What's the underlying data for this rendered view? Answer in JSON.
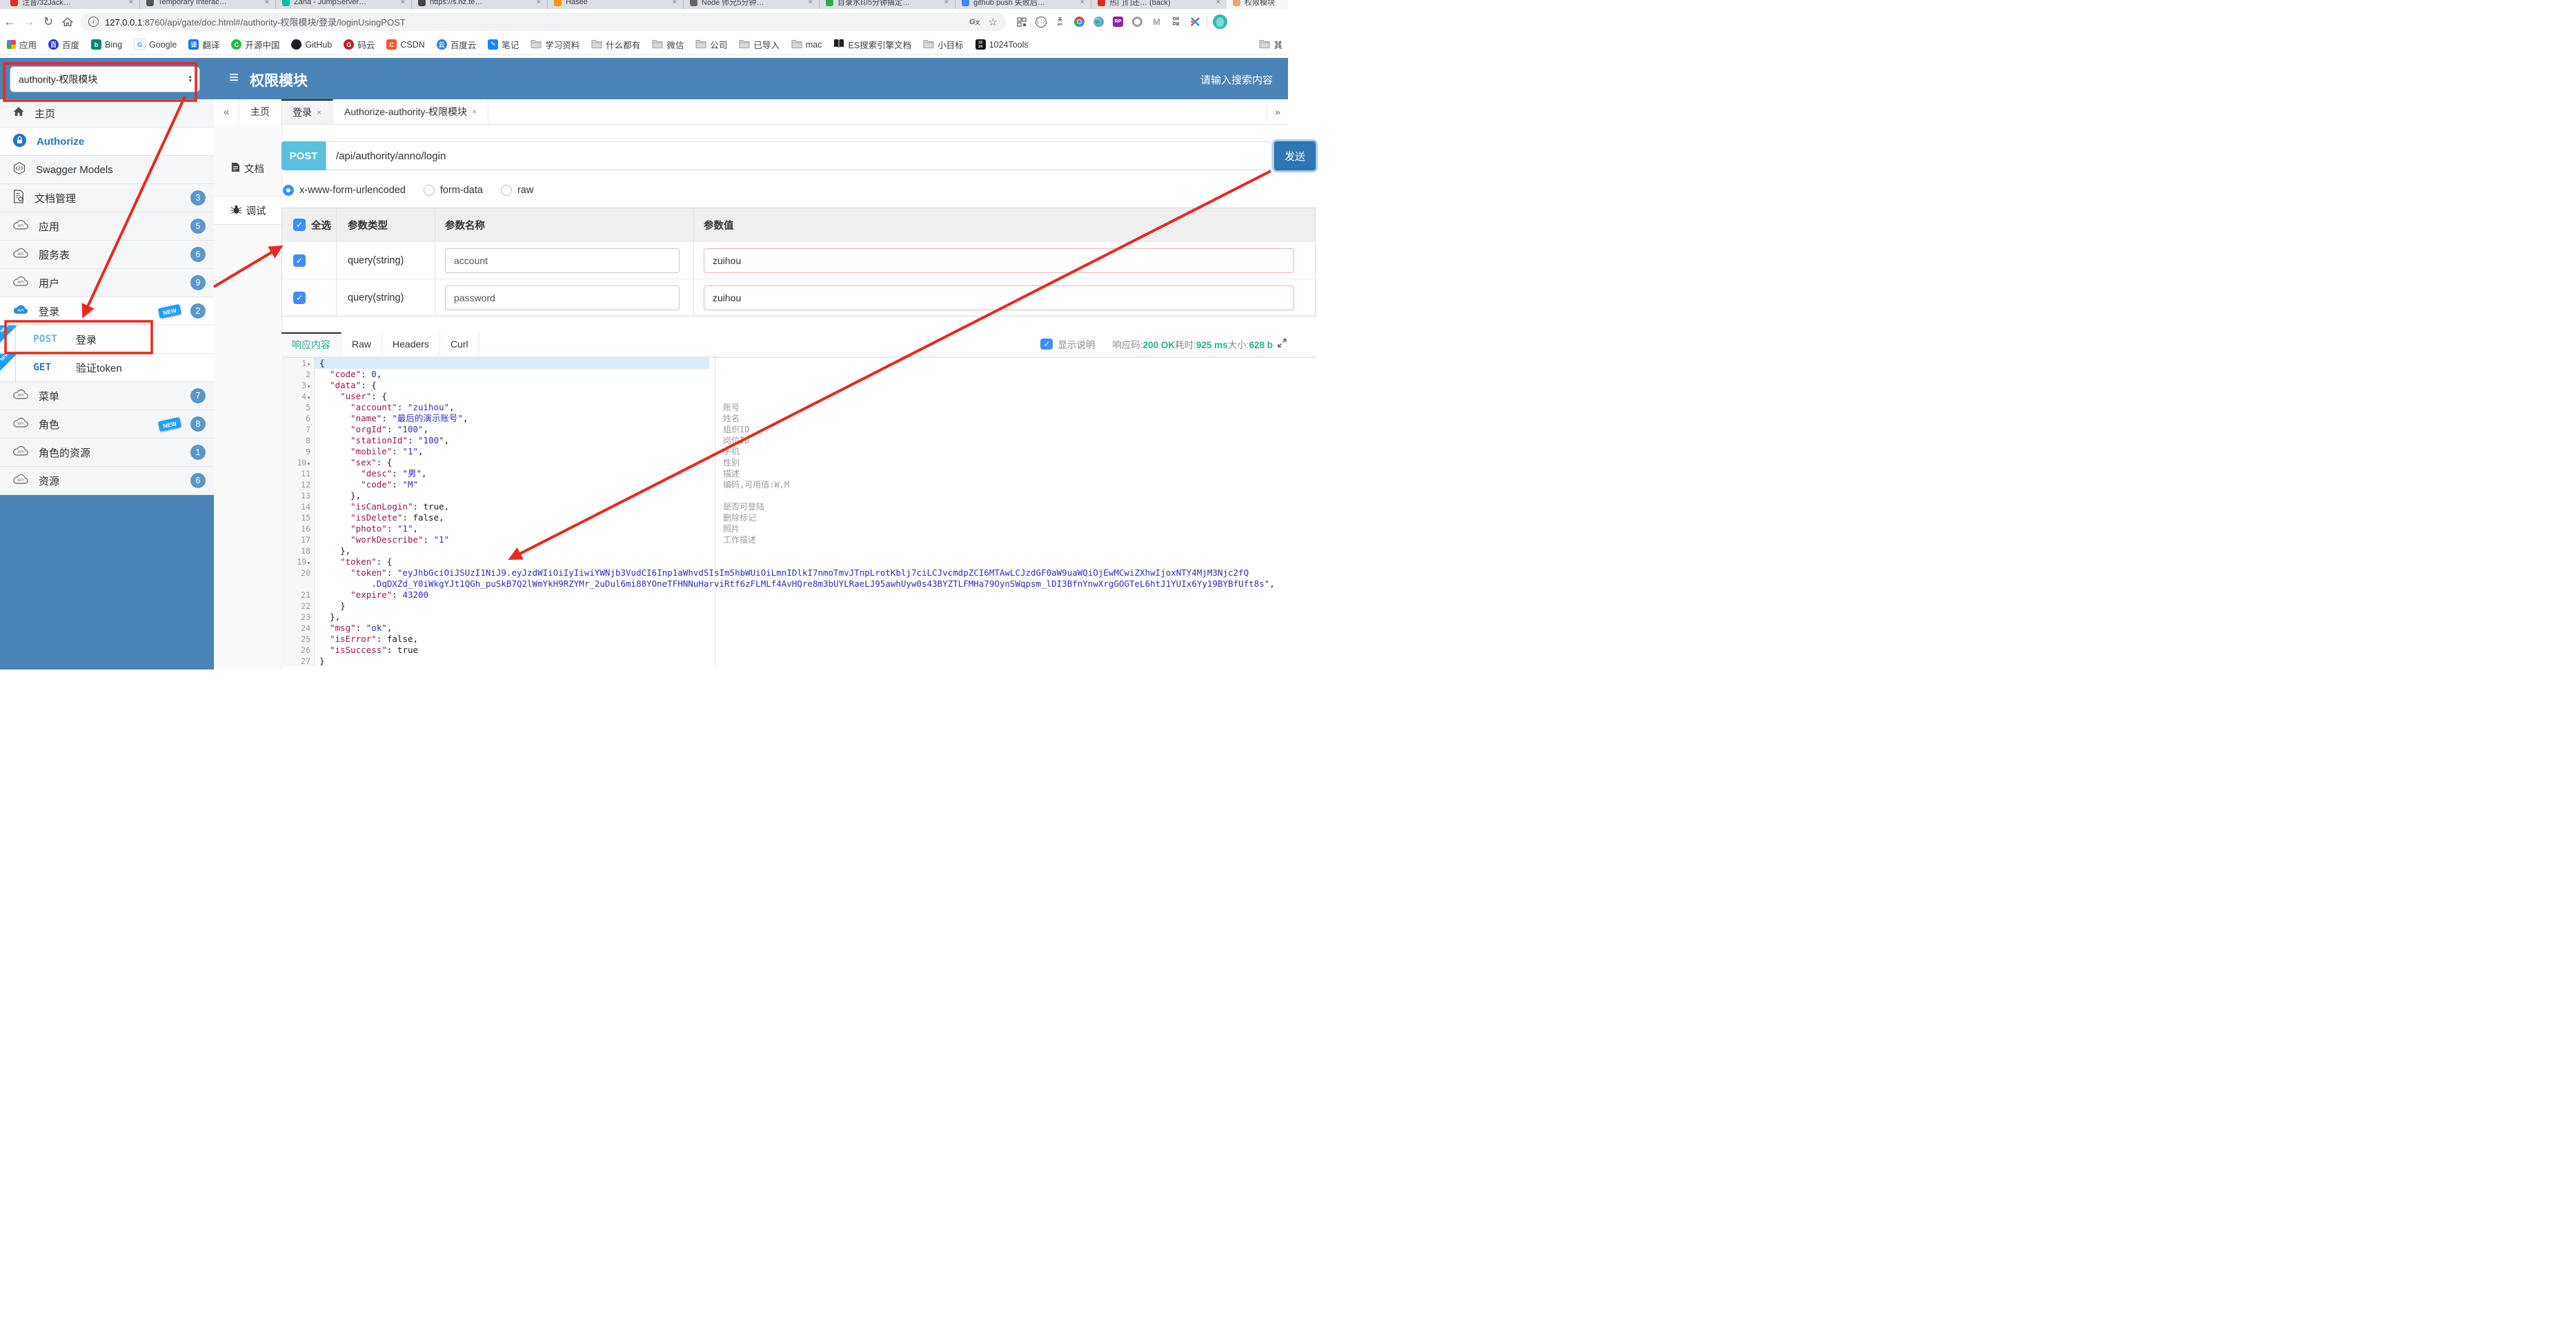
{
  "browser": {
    "tabs": [
      {
        "label": "注音/32Jack…",
        "favicon": "#d93025"
      },
      {
        "label": "Temporary Interac…",
        "favicon": "#555555"
      },
      {
        "label": "Zana - JumpServer…",
        "favicon": "#14b8a6"
      },
      {
        "label": "https://s.nz.te…",
        "favicon": "#444444"
      },
      {
        "label": "Hasee",
        "favicon": "#f29900"
      },
      {
        "label": "Node 师兄5分钟…",
        "favicon": "#666666"
      },
      {
        "label": "目录水印5分钟搞定…",
        "favicon": "#34a853"
      },
      {
        "label": "github push 失败后…",
        "favicon": "#4285f4"
      },
      {
        "label": "热门们还… (back)",
        "favicon": "#d93025"
      },
      {
        "label": "权限模块",
        "favicon": "#e8a87c",
        "active": true
      }
    ],
    "nav": {
      "back": "←",
      "forward": "→",
      "reload": "↻"
    },
    "url_host": "127.0.0.1",
    "url_rest": ":8760/api/gate/doc.html#/authority-权限模块/登录/loginUsingPOST",
    "bookmarks": [
      {
        "label": "应用",
        "icon": "grid"
      },
      {
        "label": "百度",
        "icon": "circle",
        "bg": "#2932e1",
        "ch": "百"
      },
      {
        "label": "Bing",
        "icon": "square",
        "bg": "#008373",
        "ch": "b"
      },
      {
        "label": "Google",
        "icon": "square",
        "bg": "#ffffff",
        "ch": "G",
        "fg": "#4285f4"
      },
      {
        "label": "翻译",
        "icon": "square",
        "bg": "#1a73e8",
        "ch": "译"
      },
      {
        "label": "开源中国",
        "icon": "circle",
        "bg": "#21ba45",
        "ch": "C"
      },
      {
        "label": "GitHub",
        "icon": "circle",
        "bg": "#1b1f23",
        "ch": ""
      },
      {
        "label": "码云",
        "icon": "circle",
        "bg": "#c71d23",
        "ch": "G"
      },
      {
        "label": "CSDN",
        "icon": "square",
        "bg": "#fc5531",
        "ch": "C"
      },
      {
        "label": "百度云",
        "icon": "circle",
        "bg": "#2b7de9",
        "ch": "云"
      },
      {
        "label": "笔记",
        "icon": "square",
        "bg": "#1e80ff",
        "ch": "✎"
      },
      {
        "label": "学习资料",
        "icon": "folder"
      },
      {
        "label": "什么都有",
        "icon": "folder"
      },
      {
        "label": "微信",
        "icon": "folder"
      },
      {
        "label": "公司",
        "icon": "folder"
      },
      {
        "label": "已导入",
        "icon": "folder"
      },
      {
        "label": "mac",
        "icon": "folder"
      },
      {
        "label": "ES搜索引擎文档",
        "icon": "book"
      },
      {
        "label": "小目标",
        "icon": "folder"
      },
      {
        "label": "1024Tools",
        "icon": "b1024"
      }
    ],
    "other_bookmarks": "其"
  },
  "header": {
    "module_select": "authority-权限模块",
    "menu_glyph": "≡",
    "title": "权限模块",
    "search_placeholder": "请输入搜索内容"
  },
  "sidebar": {
    "items": [
      {
        "label": "主页",
        "icon": "home-icon"
      },
      {
        "label": "Authorize",
        "icon": "lock-icon",
        "style": "auth",
        "white": true
      },
      {
        "label": "Swagger Models",
        "icon": "swagger-icon"
      },
      {
        "label": "文档管理",
        "icon": "doc-manage-icon",
        "badge": "3"
      },
      {
        "label": "应用",
        "icon": "api-cloud-icon",
        "badge": "5"
      },
      {
        "label": "服务表",
        "icon": "api-cloud-icon",
        "badge": "6"
      },
      {
        "label": "用户",
        "icon": "api-cloud-icon",
        "badge": "9"
      },
      {
        "label": "登录",
        "icon": "api-cloud-icon",
        "badge": "2",
        "new": true,
        "active": true
      },
      {
        "type": "op",
        "method": "POST",
        "label": "登录",
        "new": true
      },
      {
        "type": "op",
        "method": "GET",
        "label": "验证token",
        "new": true
      },
      {
        "label": "菜单",
        "icon": "api-cloud-icon",
        "badge": "7"
      },
      {
        "label": "角色",
        "icon": "api-cloud-icon",
        "badge": "8",
        "new": true
      },
      {
        "label": "角色的资源",
        "icon": "api-cloud-icon",
        "badge": "1"
      },
      {
        "label": "资源",
        "icon": "api-cloud-icon",
        "badge": "6"
      }
    ]
  },
  "doc_tabs": {
    "collapse": "«",
    "more": "»",
    "close_glyph": "×",
    "items": [
      {
        "label": "主页"
      },
      {
        "label": "登录",
        "closable": true,
        "active": true
      },
      {
        "label": "Authorize-authority-权限模块",
        "closable": true
      }
    ]
  },
  "mini_tabs": [
    {
      "label": "文档",
      "icon": "document-icon"
    },
    {
      "label": "调试",
      "icon": "bug-icon",
      "active": true
    }
  ],
  "request": {
    "method": "POST",
    "url": "/api/authority/anno/login",
    "send_label": "发送",
    "content_types": [
      {
        "label": "x-www-form-urlencoded",
        "selected": true
      },
      {
        "label": "form-data",
        "selected": false
      },
      {
        "label": "raw",
        "selected": false
      }
    ]
  },
  "params": {
    "header": {
      "select_all": "全选",
      "type": "参数类型",
      "name": "参数名称",
      "value": "参数值"
    },
    "rows": [
      {
        "checked": true,
        "type": "query(string)",
        "name": "account",
        "value": "zuihou"
      },
      {
        "checked": true,
        "type": "query(string)",
        "name": "password",
        "value": "zuihou"
      }
    ]
  },
  "response": {
    "tabs": [
      {
        "label": "响应内容",
        "active": true
      },
      {
        "label": "Raw"
      },
      {
        "label": "Headers"
      },
      {
        "label": "Curl"
      }
    ],
    "show_desc_label": "显示说明",
    "show_desc_checked": true,
    "stats": [
      {
        "label": "响应码:",
        "value": "200 OK"
      },
      {
        "label": "耗时:",
        "value": "925 ms"
      },
      {
        "label": "大小:",
        "value": "628 b"
      }
    ]
  },
  "editor": {
    "lines": [
      {
        "n": "1",
        "fold": true,
        "active": true,
        "segs": [
          [
            "pu",
            "{"
          ]
        ]
      },
      {
        "n": "2",
        "segs": [
          [
            "pu",
            "  "
          ],
          [
            "k",
            "\"code\""
          ],
          [
            "pu",
            ": "
          ],
          [
            "n",
            "0"
          ],
          [
            "pu",
            ","
          ]
        ]
      },
      {
        "n": "3",
        "fold": true,
        "segs": [
          [
            "pu",
            "  "
          ],
          [
            "k",
            "\"data\""
          ],
          [
            "pu",
            ": {"
          ]
        ]
      },
      {
        "n": "4",
        "fold": true,
        "segs": [
          [
            "pu",
            "    "
          ],
          [
            "k",
            "\"user\""
          ],
          [
            "pu",
            ": {"
          ]
        ]
      },
      {
        "n": "5",
        "ann": "账号",
        "segs": [
          [
            "pu",
            "      "
          ],
          [
            "k",
            "\"account\""
          ],
          [
            "pu",
            ": "
          ],
          [
            "s",
            "\"zuihou\""
          ],
          [
            "pu",
            ","
          ]
        ]
      },
      {
        "n": "6",
        "ann": "姓名",
        "segs": [
          [
            "pu",
            "      "
          ],
          [
            "k",
            "\"name\""
          ],
          [
            "pu",
            ": "
          ],
          [
            "s",
            "\"最后的演示账号\""
          ],
          [
            "pu",
            ","
          ]
        ]
      },
      {
        "n": "7",
        "ann": "组织ID",
        "segs": [
          [
            "pu",
            "      "
          ],
          [
            "k",
            "\"orgId\""
          ],
          [
            "pu",
            ": "
          ],
          [
            "s",
            "\"100\""
          ],
          [
            "pu",
            ","
          ]
        ]
      },
      {
        "n": "8",
        "ann": "岗位ID",
        "segs": [
          [
            "pu",
            "      "
          ],
          [
            "k",
            "\"stationId\""
          ],
          [
            "pu",
            ": "
          ],
          [
            "s",
            "\"100\""
          ],
          [
            "pu",
            ","
          ]
        ]
      },
      {
        "n": "9",
        "ann": "手机",
        "segs": [
          [
            "pu",
            "      "
          ],
          [
            "k",
            "\"mobile\""
          ],
          [
            "pu",
            ": "
          ],
          [
            "s",
            "\"1\""
          ],
          [
            "pu",
            ","
          ]
        ]
      },
      {
        "n": "10",
        "fold": true,
        "ann": "性别",
        "segs": [
          [
            "pu",
            "      "
          ],
          [
            "k",
            "\"sex\""
          ],
          [
            "pu",
            ": {"
          ]
        ]
      },
      {
        "n": "11",
        "ann": "描述",
        "segs": [
          [
            "pu",
            "        "
          ],
          [
            "k",
            "\"desc\""
          ],
          [
            "pu",
            ": "
          ],
          [
            "s",
            "\"男\""
          ],
          [
            "pu",
            ","
          ]
        ]
      },
      {
        "n": "12",
        "ann": "编码,可用值:W,M",
        "segs": [
          [
            "pu",
            "        "
          ],
          [
            "k",
            "\"code\""
          ],
          [
            "pu",
            ": "
          ],
          [
            "s",
            "\"M\""
          ]
        ]
      },
      {
        "n": "13",
        "segs": [
          [
            "pu",
            "      },"
          ]
        ]
      },
      {
        "n": "14",
        "ann": "是否可登陆",
        "segs": [
          [
            "pu",
            "      "
          ],
          [
            "k",
            "\"isCanLogin\""
          ],
          [
            "pu",
            ": "
          ],
          [
            "b",
            "true"
          ],
          [
            "pu",
            ","
          ]
        ]
      },
      {
        "n": "15",
        "ann": "删除标记",
        "segs": [
          [
            "pu",
            "      "
          ],
          [
            "k",
            "\"isDelete\""
          ],
          [
            "pu",
            ": "
          ],
          [
            "b",
            "false"
          ],
          [
            "pu",
            ","
          ]
        ]
      },
      {
        "n": "16",
        "ann": "照片",
        "segs": [
          [
            "pu",
            "      "
          ],
          [
            "k",
            "\"photo\""
          ],
          [
            "pu",
            ": "
          ],
          [
            "s",
            "\"1\""
          ],
          [
            "pu",
            ","
          ]
        ]
      },
      {
        "n": "17",
        "ann": "工作描述",
        "segs": [
          [
            "pu",
            "      "
          ],
          [
            "k",
            "\"workDescribe\""
          ],
          [
            "pu",
            ": "
          ],
          [
            "s",
            "\"1\""
          ]
        ]
      },
      {
        "n": "18",
        "segs": [
          [
            "pu",
            "    },"
          ]
        ]
      },
      {
        "n": "19",
        "fold": true,
        "segs": [
          [
            "pu",
            "    "
          ],
          [
            "k",
            "\"token\""
          ],
          [
            "pu",
            ": {"
          ]
        ]
      },
      {
        "n": "20",
        "segs": [
          [
            "pu",
            "      "
          ],
          [
            "k",
            "\"token\""
          ],
          [
            "pu",
            ": "
          ],
          [
            "s",
            "\"eyJhbGciOiJSUzI1NiJ9.eyJzdWIiOiIyIiwiYWNjb3VudCI6Inp1aWhvdSIsIm5hbWUiOiLmnIDlkI7nmoTmvJTnpLrotKblj7ciLCJvcmdpZCI6MTAwLCJzdGF0aW9uaWQiOjEwMCwiZXhwIjoxNTY4MjM3Njc2fQ"
          ]
        ]
      },
      {
        "segs": [
          [
            "pu",
            "          "
          ],
          [
            "s",
            ".DqDXZd_Y0iWkgYJt1QGh_puSkB7Q2lWmYkH9RZYMr_2uDul6mi88YOneTFHNNuHarviRtf6zFLMLf4AvHQre8m3bUYLRaeLJ95awhUyw0s43BYZTLFMHa79OynSWqpsm_lDI3BfnYnwXrgGOGTeL6htJ1YUIx6Yy19BYBfUft8s\""
          ],
          [
            "pu",
            ","
          ]
        ]
      },
      {
        "n": "21",
        "segs": [
          [
            "pu",
            "      "
          ],
          [
            "k",
            "\"expire\""
          ],
          [
            "pu",
            ": "
          ],
          [
            "n",
            "43200"
          ]
        ]
      },
      {
        "n": "22",
        "segs": [
          [
            "pu",
            "    }"
          ]
        ]
      },
      {
        "n": "23",
        "segs": [
          [
            "pu",
            "  },"
          ]
        ]
      },
      {
        "n": "24",
        "segs": [
          [
            "pu",
            "  "
          ],
          [
            "k",
            "\"msg\""
          ],
          [
            "pu",
            ": "
          ],
          [
            "s",
            "\"ok\""
          ],
          [
            "pu",
            ","
          ]
        ]
      },
      {
        "n": "25",
        "segs": [
          [
            "pu",
            "  "
          ],
          [
            "k",
            "\"isError\""
          ],
          [
            "pu",
            ": "
          ],
          [
            "b",
            "false"
          ],
          [
            "pu",
            ","
          ]
        ]
      },
      {
        "n": "26",
        "segs": [
          [
            "pu",
            "  "
          ],
          [
            "k",
            "\"isSuccess\""
          ],
          [
            "pu",
            ": "
          ],
          [
            "b",
            "true"
          ]
        ]
      },
      {
        "n": "27",
        "segs": [
          [
            "pu",
            "}"
          ]
        ]
      }
    ]
  }
}
